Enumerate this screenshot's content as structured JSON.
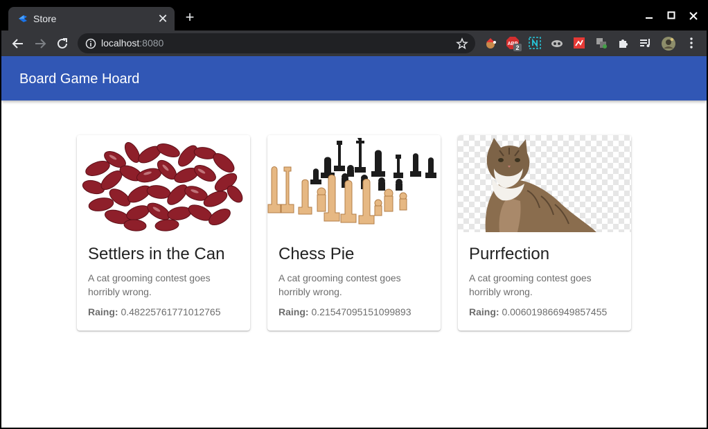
{
  "browser": {
    "tab": {
      "title": "Store",
      "close_glyph": "✕"
    },
    "new_tab_glyph": "+",
    "address": {
      "host": "localhost",
      "port": ":8080"
    },
    "extensions": [
      "santa-cookie-icon",
      "adblock-plus-icon",
      "notion-icon",
      "cloud-sync-icon",
      "screenshot-icon",
      "chip-extension-icon",
      "extensions-puzzle-icon",
      "media-queue-icon",
      "profile-avatar-icon"
    ],
    "abp_badge": "2"
  },
  "app": {
    "title": "Board Game Hoard",
    "header_color": "#3157b5"
  },
  "cards": [
    {
      "title": "Settlers in the Can",
      "description": "A cat grooming contest goes horribly wrong.",
      "rating_label": "Raing:",
      "rating_value": "0.48225761771012765",
      "image": "kidney-beans-image"
    },
    {
      "title": "Chess Pie",
      "description": "A cat grooming contest goes horribly wrong.",
      "rating_label": "Raing:",
      "rating_value": "0.21547095151099893",
      "image": "chess-pieces-image"
    },
    {
      "title": "Purrfection",
      "description": "A cat grooming contest goes horribly wrong.",
      "rating_label": "Raing:",
      "rating_value": "0.006019866949857455",
      "image": "tabby-cat-image"
    }
  ]
}
